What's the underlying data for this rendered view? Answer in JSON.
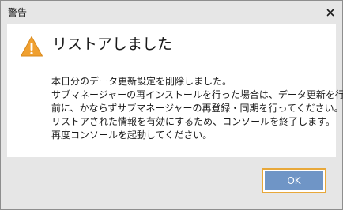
{
  "window": {
    "title": "警告",
    "close_glyph": "×"
  },
  "dialog": {
    "icon": "warning-triangle-icon",
    "heading": "リストアしました",
    "message_lines": [
      "本日分のデータ更新設定を削除しました。",
      "サブマネージャーの再インストールを行った場合は、データ更新を行う",
      "前に、かならずサブマネージャーの再登録・同期を行ってください。",
      "リストアされた情報を有効にするため、コンソールを終了します。",
      "再度コンソールを起動してください。"
    ]
  },
  "buttons": {
    "ok_label": "OK"
  },
  "colors": {
    "titlebar_bg": "#e6e6e6",
    "content_bg": "#ffffff",
    "ok_button_bg": "#6f95c6",
    "focus_ring": "#e8a83a",
    "warning_fill": "#f0a030"
  }
}
